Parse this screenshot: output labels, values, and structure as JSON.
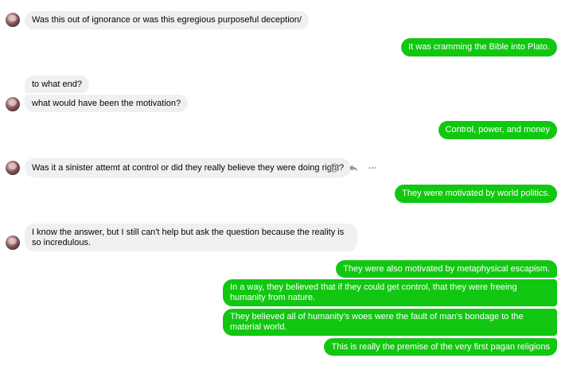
{
  "messages": [
    {
      "side": "in",
      "text": "Was this out of ignorance or was this egregious purposeful deception/"
    },
    {
      "side": "out",
      "text": "It was cramming the Bible into Plato."
    },
    {
      "side": "in",
      "text": "to what end?"
    },
    {
      "side": "in",
      "text": "what would have been the motivation?"
    },
    {
      "side": "out",
      "text": "Control, power, and money"
    },
    {
      "side": "in",
      "text": "Was it a sinister attemt at control or did they really believe they were doing right?"
    },
    {
      "side": "out",
      "text": "They were motivated by world politics."
    },
    {
      "side": "in",
      "text": "I know the answer, but I still can't help but ask the question because the reality is so incredulous."
    },
    {
      "side": "out",
      "text": "They were also motivated by metaphysical escapism."
    },
    {
      "side": "out",
      "text": "In a way, they believed that if they could get control, that they were freeing humanity from nature."
    },
    {
      "side": "out",
      "text": "They believed all of humanity's woes were the fault of man's bondage to the material world."
    },
    {
      "side": "out",
      "text": "This is really the premise of the very first pagan religions"
    }
  ],
  "hover_actions": {
    "icons": [
      "emoji-react-icon",
      "reply-icon",
      "more-options-icon"
    ]
  },
  "colors": {
    "outgoing_bubble": "#12c712",
    "incoming_bubble": "#f0f0f0"
  }
}
